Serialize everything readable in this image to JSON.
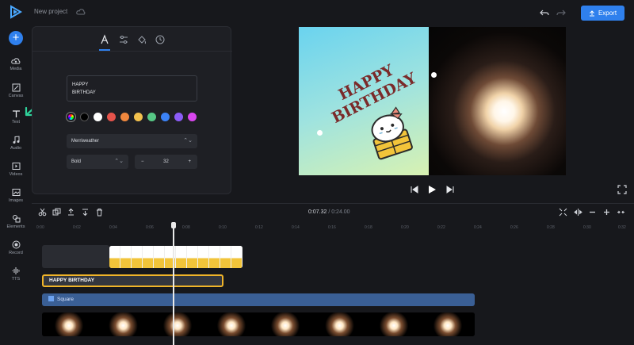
{
  "header": {
    "project_name": "New project",
    "export_label": "Export"
  },
  "rail": {
    "items": [
      {
        "label": "Media"
      },
      {
        "label": "Canvas"
      },
      {
        "label": "Text"
      },
      {
        "label": "Audio"
      },
      {
        "label": "Videos"
      },
      {
        "label": "Images"
      },
      {
        "label": "Elements"
      },
      {
        "label": "Record"
      },
      {
        "label": "TTS"
      }
    ]
  },
  "text_panel": {
    "text_value": "HAPPY\nBIRTHDAY",
    "font": "Merriweather",
    "weight": "Bold",
    "size": "32",
    "colors": [
      "#000000",
      "#ffffff",
      "#e5534b",
      "#f0883e",
      "#f2c14e",
      "#57c785",
      "#3b82f6",
      "#8b5cf6",
      "#d946ef"
    ]
  },
  "canvas": {
    "headline": "HAPPY\nBIRTHDAY"
  },
  "timeline": {
    "current_time": "0:07.32",
    "separator": "/",
    "total_time": "0:24.00",
    "ticks": [
      "0:00",
      "0:02",
      "0:04",
      "0:06",
      "0:08",
      "0:10",
      "0:12",
      "0:14",
      "0:16",
      "0:18",
      "0:20",
      "0:22",
      "0:24",
      "0:26",
      "0:28",
      "0:30",
      "0:32"
    ],
    "text_clip_label": "HAPPY BIRTHDAY",
    "square_clip_label": "Square"
  }
}
